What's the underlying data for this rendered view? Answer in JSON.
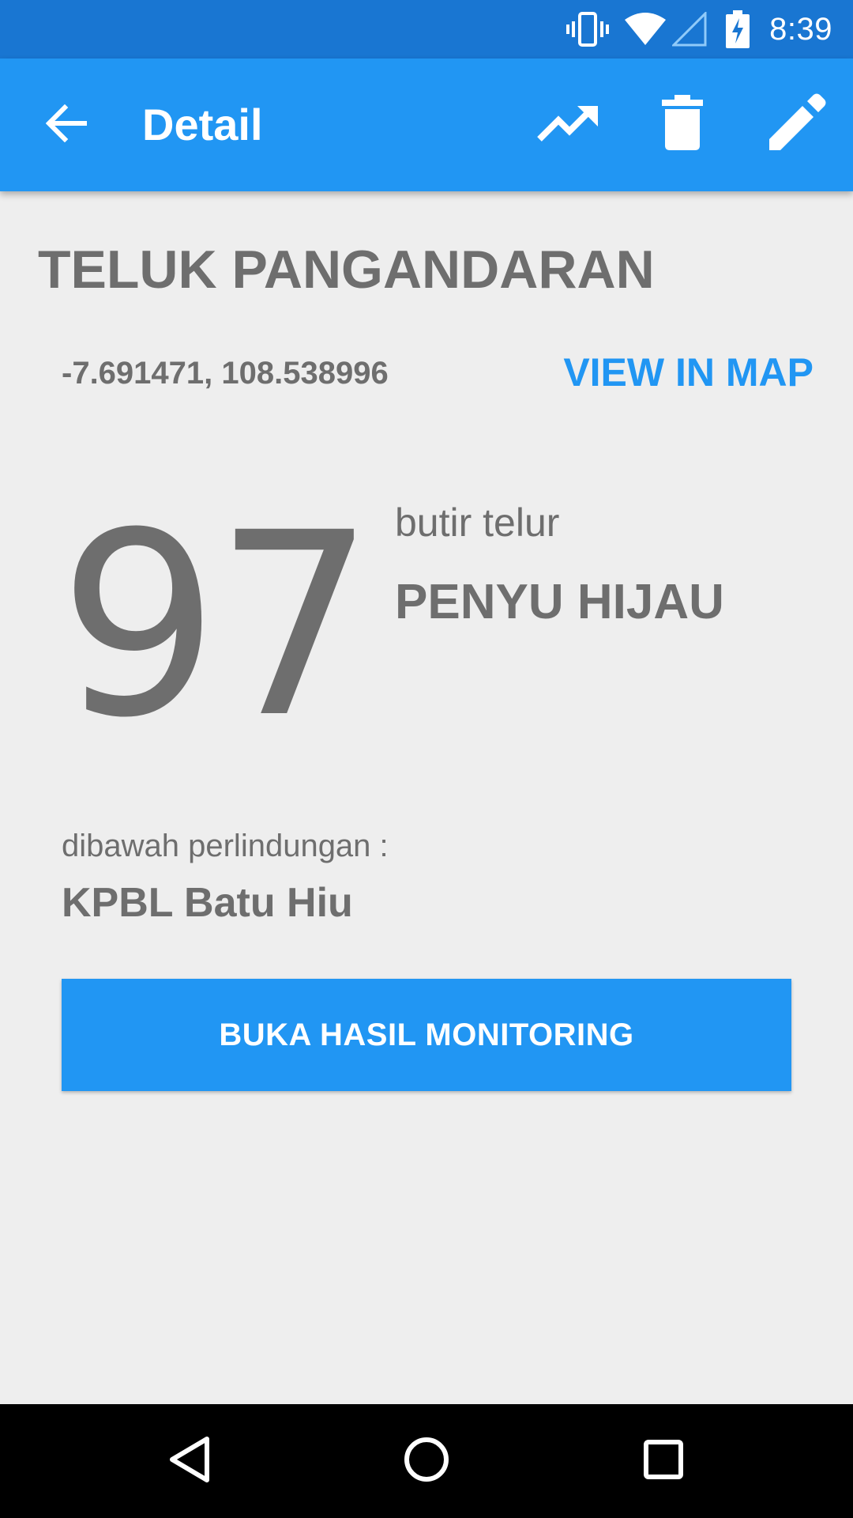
{
  "status_bar": {
    "time": "8:39",
    "icons": [
      "vibrate-icon",
      "wifi-icon",
      "cell-signal-icon",
      "battery-charging-icon"
    ]
  },
  "app_bar": {
    "title": "Detail",
    "back_icon": "arrow-back-icon",
    "actions": [
      "trending-up-icon",
      "delete-icon",
      "edit-icon"
    ],
    "color": "#2196f3",
    "status_color": "#1976d2"
  },
  "detail": {
    "location_name": "TELUK PANGANDARAN",
    "coordinates": "-7.691471, 108.538996",
    "view_map_label": "VIEW IN MAP",
    "egg_count": "97",
    "count_unit": "butir telur",
    "species": "PENYU HIJAU",
    "protection_label": "dibawah perlindungan :",
    "protection_org": "KPBL Batu Hiu",
    "monitor_button_label": "BUKA HASIL MONITORING"
  },
  "nav_bar": {
    "buttons": [
      "nav-back-icon",
      "nav-home-icon",
      "nav-recents-icon"
    ]
  }
}
